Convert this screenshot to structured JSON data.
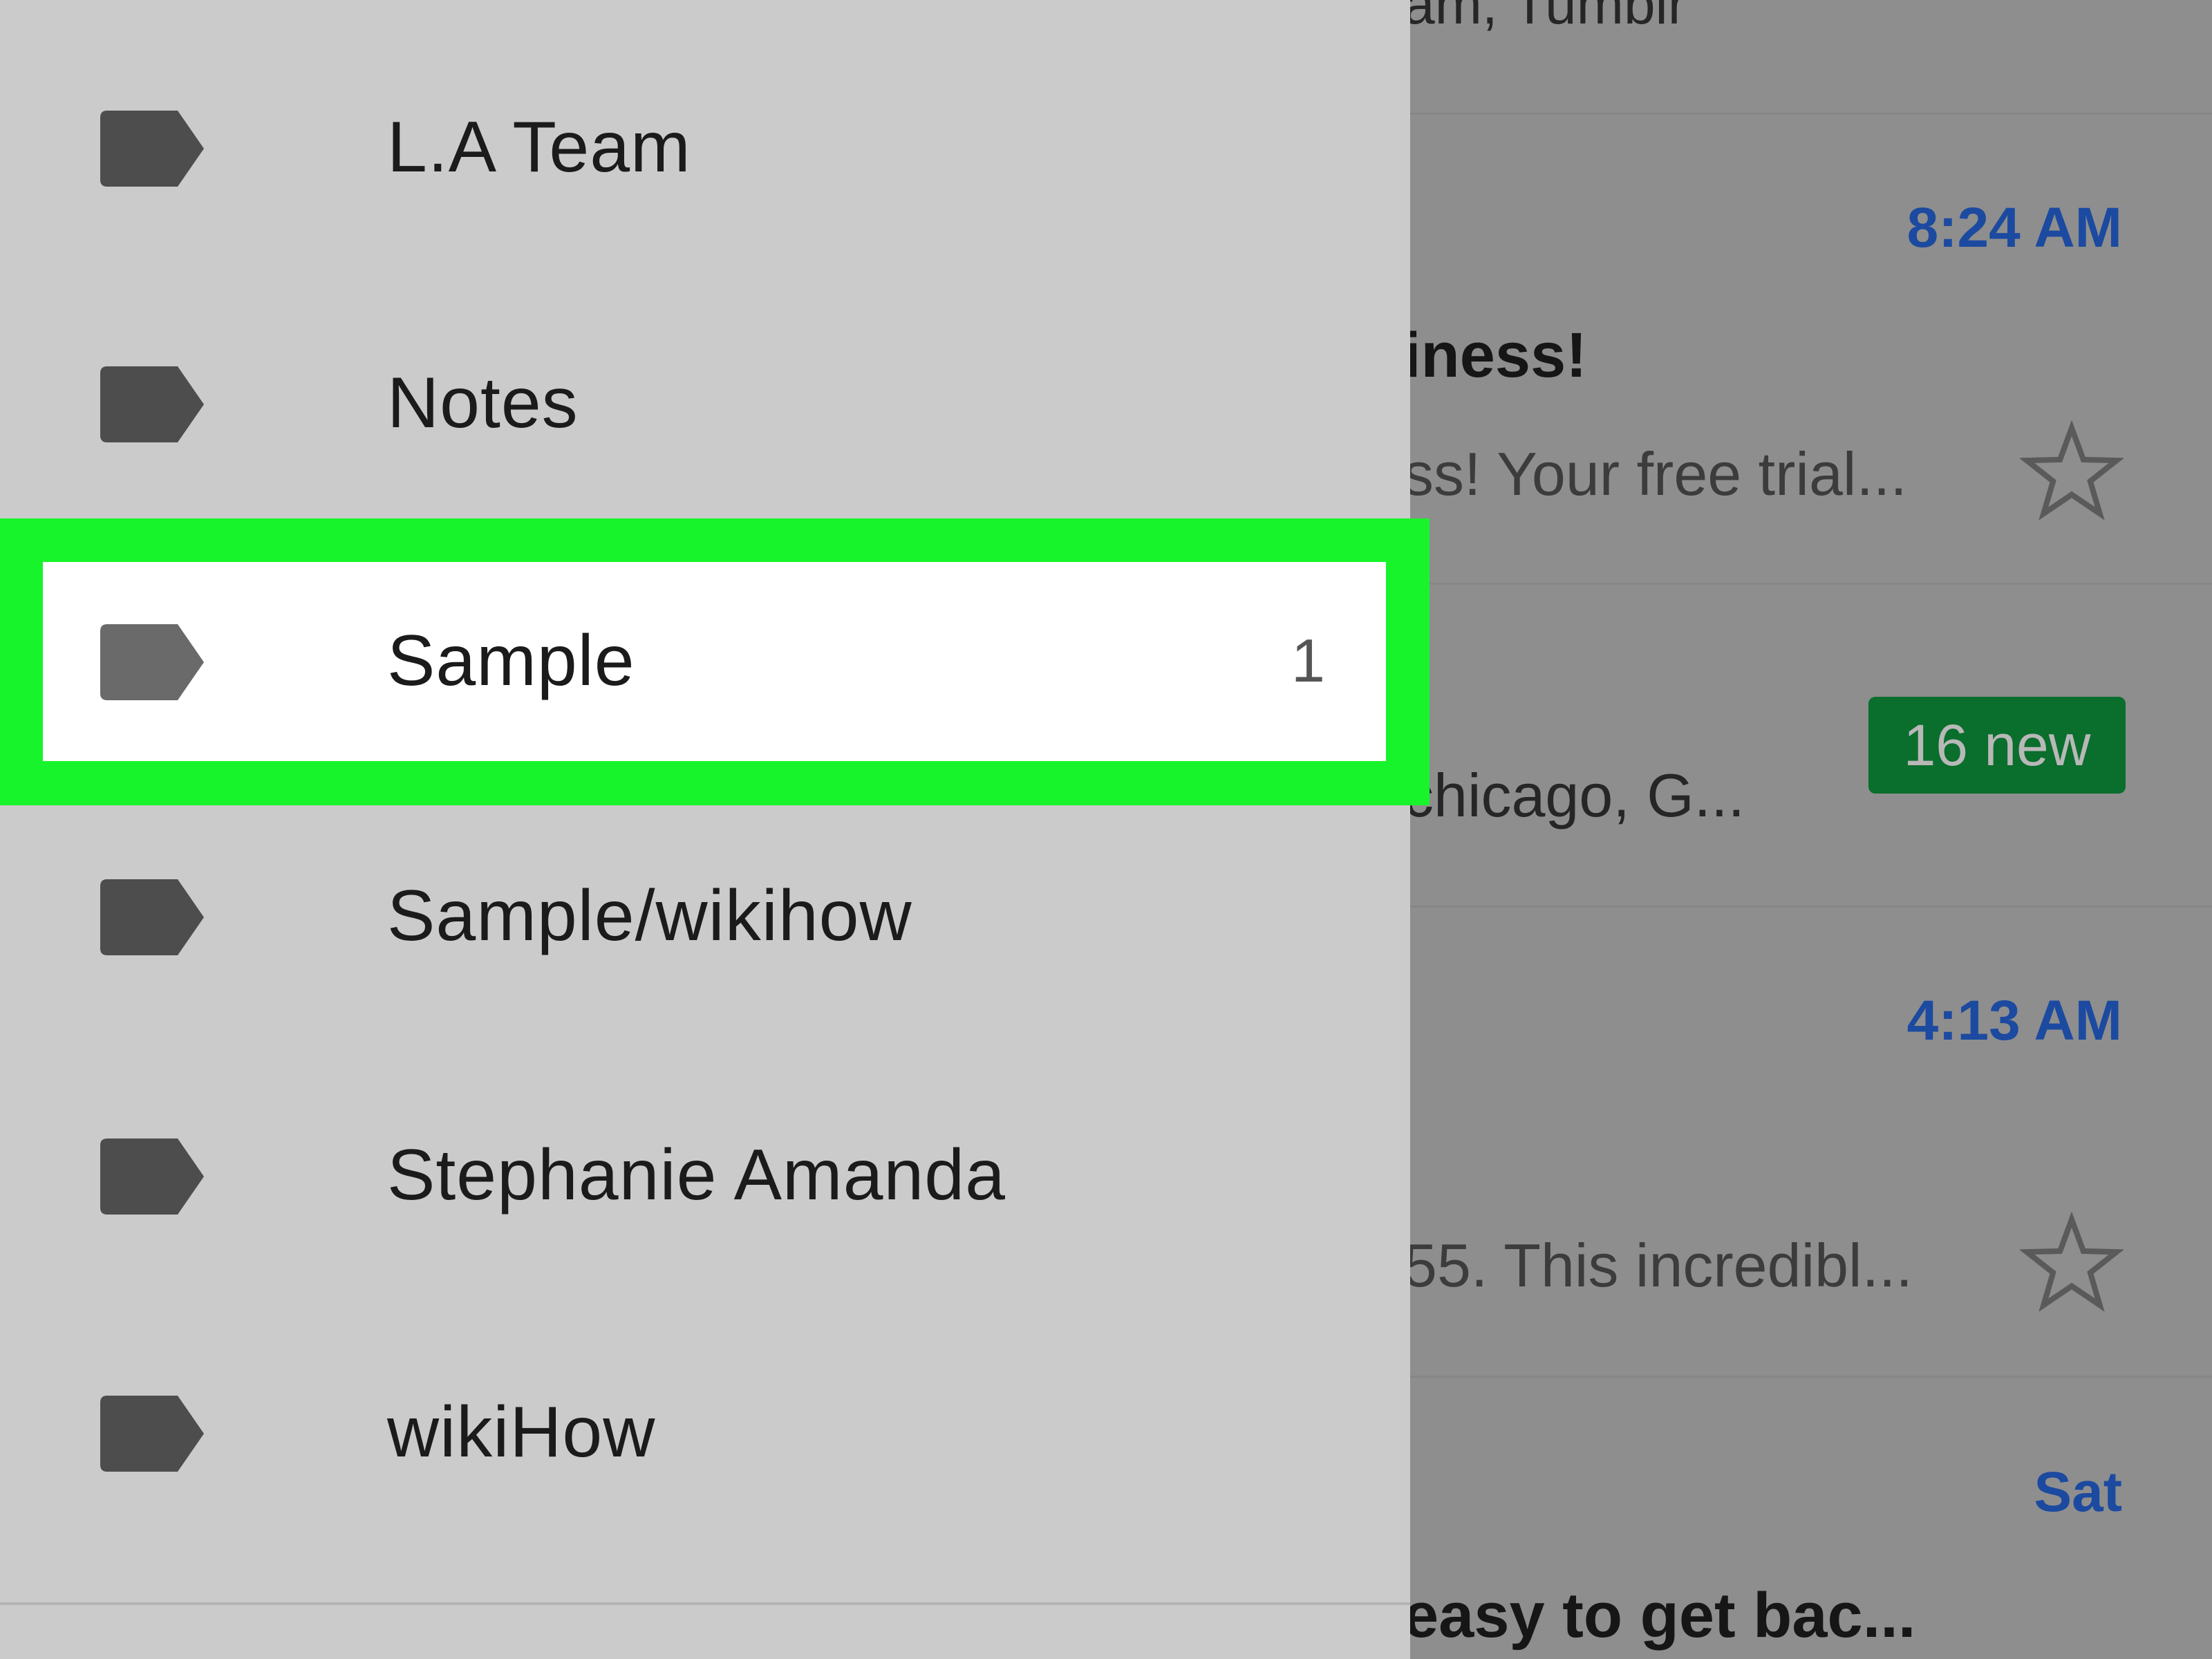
{
  "drawer": {
    "labels": [
      {
        "name": "L.A Team"
      },
      {
        "name": "Notes"
      },
      {
        "name": "Sample",
        "count": "1",
        "selected": true
      },
      {
        "name": "Sample/wikihow"
      },
      {
        "name": "Stephanie Amanda"
      },
      {
        "name": "wikiHow"
      }
    ],
    "label_icon": "label-tag-icon",
    "highlight_color": "#18f42c"
  },
  "emails": [
    {
      "sender": "am, Tumblr"
    },
    {
      "time": "8:24 AM",
      "subject": "iness!",
      "snippet": "ss! Your free trial...",
      "star_icon": "star-outline-icon"
    },
    {
      "badge": "16 new",
      "sender": "chicago, G..."
    },
    {
      "time": "4:13 AM",
      "snippet": "55. This incredibl...",
      "star_icon": "star-outline-icon"
    },
    {
      "time": "Sat",
      "subject": "easy to get bac..."
    }
  ],
  "colors": {
    "time_blue": "#1b4aa0",
    "badge_green": "#0a6e2c"
  }
}
